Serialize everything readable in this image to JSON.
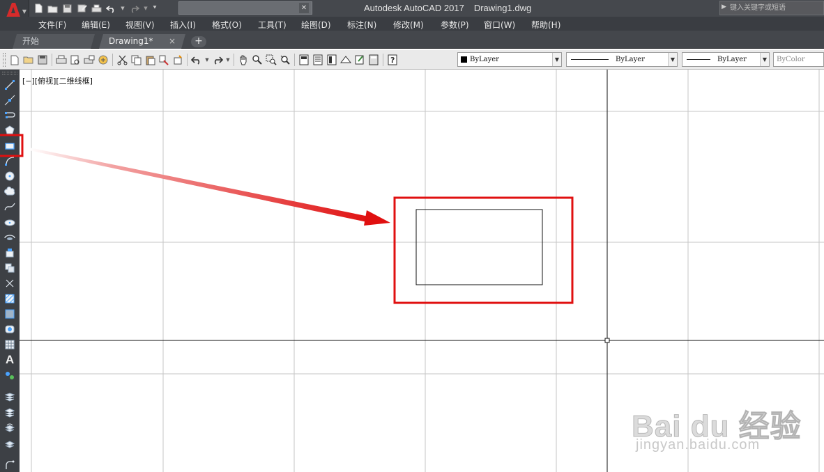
{
  "titlebar": {
    "app_name": "Autodesk AutoCAD 2017",
    "file_name": "Drawing1.dwg",
    "search_placeholder": "键入关键字或短语"
  },
  "menu": [
    {
      "label": "文件(F)"
    },
    {
      "label": "编辑(E)"
    },
    {
      "label": "视图(V)"
    },
    {
      "label": "插入(I)"
    },
    {
      "label": "格式(O)"
    },
    {
      "label": "工具(T)"
    },
    {
      "label": "绘图(D)"
    },
    {
      "label": "标注(N)"
    },
    {
      "label": "修改(M)"
    },
    {
      "label": "参数(P)"
    },
    {
      "label": "窗口(W)"
    },
    {
      "label": "帮助(H)"
    }
  ],
  "tabs": [
    {
      "label": "开始",
      "active": false
    },
    {
      "label": "Drawing1*",
      "active": true
    }
  ],
  "tab_add_label": "+",
  "tab_close_label": "×",
  "properties": {
    "color": "ByLayer",
    "linetype": "ByLayer",
    "lineweight": "ByLayer",
    "plotstyle": "ByColor"
  },
  "canvas": {
    "view_label": "[−][俯视][二维线框]"
  },
  "left_tools": {
    "text_tool_label": "A"
  },
  "watermark": {
    "brand": "Bai du 经验",
    "url": "jingyan.baidu.com"
  },
  "colors": {
    "annotation_red": "#e01010",
    "dark_ui": "#3d4045",
    "autocad_logo_red": "#d62b2b"
  }
}
